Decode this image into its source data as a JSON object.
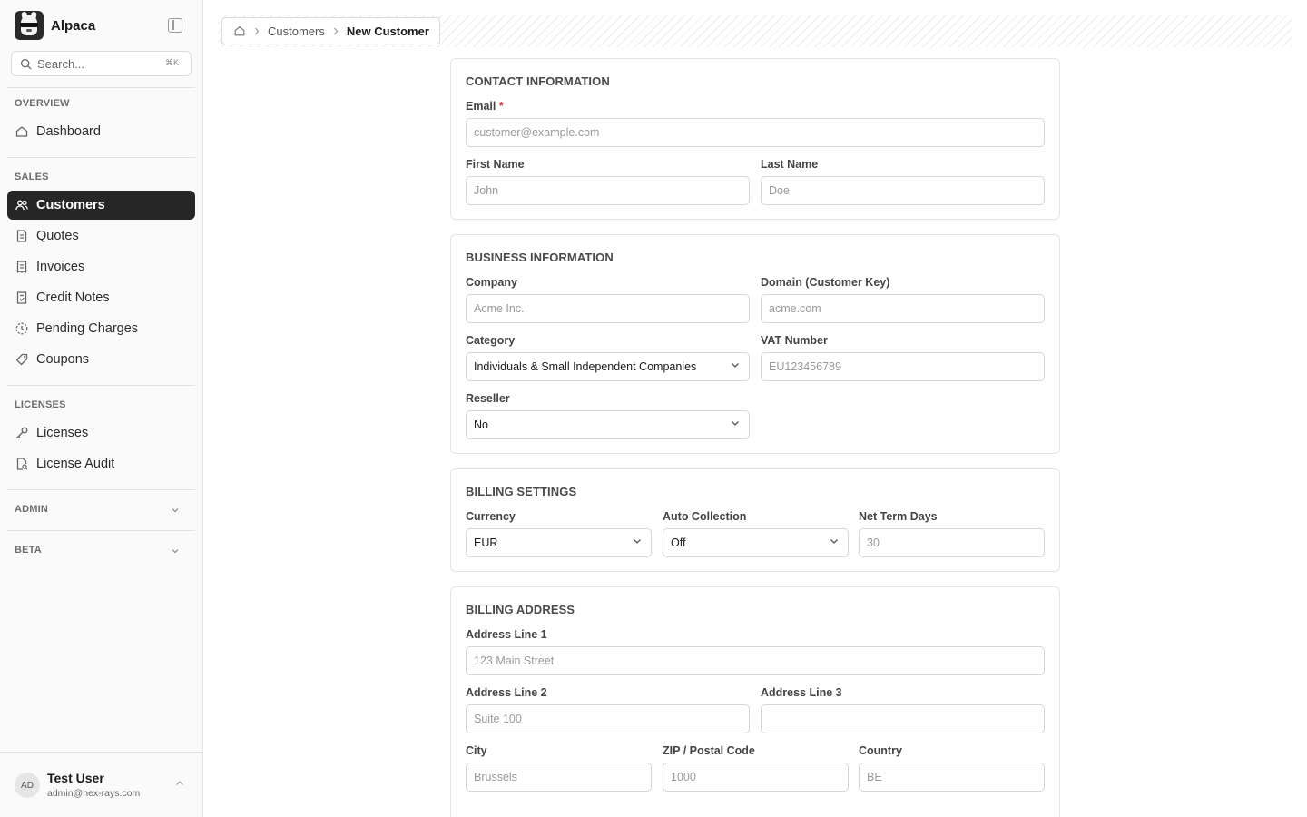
{
  "app": {
    "name": "Alpaca"
  },
  "search": {
    "placeholder": "Search...",
    "shortcut": "⌘K"
  },
  "sidebar": {
    "overview_label": "OVERVIEW",
    "dashboard": "Dashboard",
    "sales_label": "SALES",
    "customers": "Customers",
    "quotes": "Quotes",
    "invoices": "Invoices",
    "credit_notes": "Credit Notes",
    "pending_charges": "Pending Charges",
    "coupons": "Coupons",
    "licenses_label": "LICENSES",
    "licenses": "Licenses",
    "license_audit": "License Audit",
    "admin_label": "ADMIN",
    "beta_label": "BETA",
    "active_item": "Customers"
  },
  "user": {
    "initials": "AD",
    "name": "Test User",
    "email": "admin@hex-rays.com"
  },
  "breadcrumb": {
    "parent": "Customers",
    "current": "New Customer"
  },
  "contact": {
    "title": "CONTACT INFORMATION",
    "email_label": "Email",
    "email_required": "*",
    "email_placeholder": "customer@example.com",
    "first_name_label": "First Name",
    "first_name_placeholder": "John",
    "last_name_label": "Last Name",
    "last_name_placeholder": "Doe"
  },
  "business": {
    "title": "BUSINESS INFORMATION",
    "company_label": "Company",
    "company_placeholder": "Acme Inc.",
    "domain_label": "Domain (Customer Key)",
    "domain_placeholder": "acme.com",
    "category_label": "Category",
    "category_value": "Individuals & Small Independent Companies",
    "vat_label": "VAT Number",
    "vat_placeholder": "EU123456789",
    "reseller_label": "Reseller",
    "reseller_value": "No"
  },
  "billing_settings": {
    "title": "BILLING SETTINGS",
    "currency_label": "Currency",
    "currency_value": "EUR",
    "auto_collection_label": "Auto Collection",
    "auto_collection_value": "Off",
    "net_term_label": "Net Term Days",
    "net_term_placeholder": "30"
  },
  "billing_address": {
    "title": "BILLING ADDRESS",
    "line1_label": "Address Line 1",
    "line1_placeholder": "123 Main Street",
    "line2_label": "Address Line 2",
    "line2_placeholder": "Suite 100",
    "line3_label": "Address Line 3",
    "line3_placeholder": "",
    "city_label": "City",
    "city_placeholder": "Brussels",
    "zip_label": "ZIP / Postal Code",
    "zip_placeholder": "1000",
    "country_label": "Country",
    "country_placeholder": "BE"
  },
  "colors": {
    "active_nav_bg": "#262626",
    "required": "#d33333",
    "border": "#d6d6d6"
  }
}
